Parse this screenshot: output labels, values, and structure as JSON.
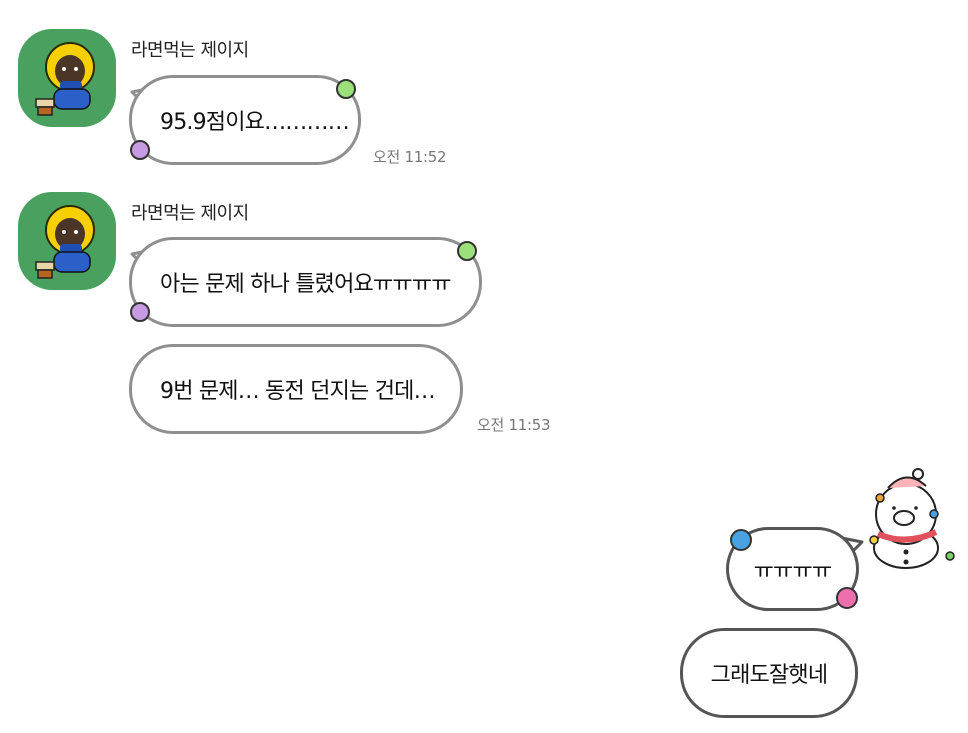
{
  "messages": [
    {
      "sender": "라면먹는 제이지",
      "text": "95.9점이요…………",
      "time": "오전 11:52"
    },
    {
      "sender": "라면먹는 제이지",
      "text": "아는 문제 하나 틀렸어요ㅠㅠㅠㅠ"
    },
    {
      "text": "9번 문제… 동전 던지는 건데…",
      "time": "오전 11:53"
    }
  ],
  "my_messages": [
    {
      "text": "ㅠㅠㅠㅠ"
    },
    {
      "text": "그래도잘햇네"
    }
  ],
  "colors": {
    "avatar_bg": "#4aa15f",
    "bubble_border": "#8f8f8f",
    "dot_green": "#9be07a",
    "dot_purple": "#c79be3",
    "dot_blue": "#4aa2e0",
    "dot_pink": "#ee6fae"
  },
  "icons": {
    "avatar": "jay-g-character-icon",
    "sticker": "snowman-sticker-icon"
  }
}
